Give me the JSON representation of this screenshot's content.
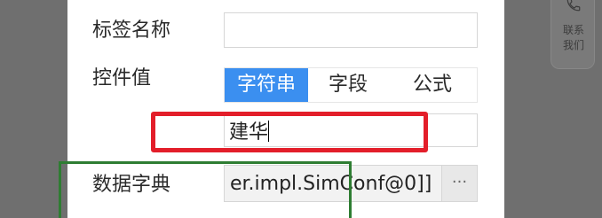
{
  "form": {
    "tag_name_label": "标签名称",
    "tag_name_value": "",
    "control_value_label": "控件值",
    "tabs": [
      {
        "label": "字符串",
        "active": true
      },
      {
        "label": "字段",
        "active": false
      },
      {
        "label": "公式",
        "active": false
      }
    ],
    "string_value": "建华",
    "data_dict_label": "数据字典",
    "data_dict_value": "er.impl.SimConf@0]]",
    "data_dict_button": "···"
  },
  "side_widget": {
    "icon": "phone-icon",
    "line1": "联系",
    "line2": "我们"
  },
  "colors": {
    "accent": "#3b8ff0",
    "highlight_red": "#e31e2a",
    "highlight_green": "#2e7d32"
  }
}
